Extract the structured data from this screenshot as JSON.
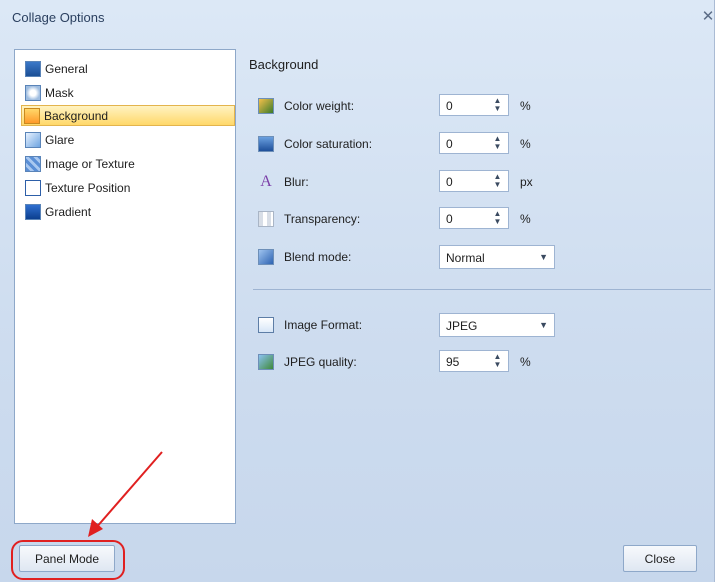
{
  "window": {
    "title": "Collage Options"
  },
  "nav": {
    "items": [
      {
        "label": "General",
        "icon": "general-icon"
      },
      {
        "label": "Mask",
        "icon": "mask-icon"
      },
      {
        "label": "Background",
        "icon": "background-icon",
        "selected": true
      },
      {
        "label": "Glare",
        "icon": "glare-icon"
      },
      {
        "label": "Image or Texture",
        "icon": "image-texture-icon"
      },
      {
        "label": "Texture Position",
        "icon": "texture-position-icon"
      },
      {
        "label": "Gradient",
        "icon": "gradient-icon"
      }
    ]
  },
  "panel": {
    "title": "Background",
    "color_weight": {
      "label": "Color weight:",
      "value": "0",
      "unit": "%"
    },
    "color_saturation": {
      "label": "Color saturation:",
      "value": "0",
      "unit": "%"
    },
    "blur": {
      "label": "Blur:",
      "value": "0",
      "unit": "px"
    },
    "transparency": {
      "label": "Transparency:",
      "value": "0",
      "unit": "%"
    },
    "blend_mode": {
      "label": "Blend mode:",
      "value": "Normal"
    },
    "image_format": {
      "label": "Image Format:",
      "value": "JPEG"
    },
    "jpeg_quality": {
      "label": "JPEG quality:",
      "value": "95",
      "unit": "%"
    }
  },
  "footer": {
    "panel_mode_label": "Panel Mode",
    "close_label": "Close"
  },
  "colors": {
    "accent": "#ffd86a",
    "annotation": "#e02020"
  }
}
